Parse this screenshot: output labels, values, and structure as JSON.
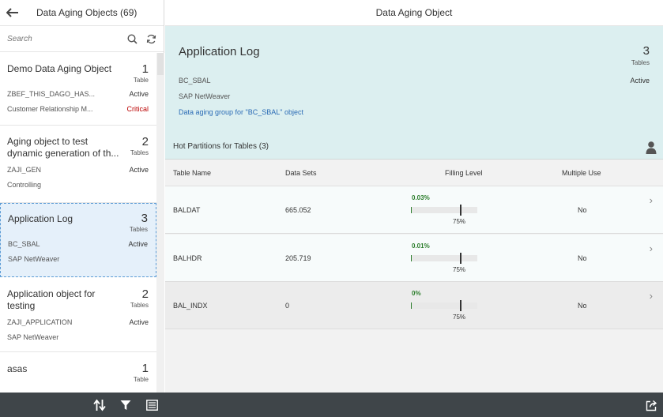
{
  "master": {
    "title": "Data Aging Objects (69)",
    "search_placeholder": "Search",
    "items": [
      {
        "title": "Demo Data Aging Object",
        "count": "1",
        "unit": "Table",
        "attr1": "ZBEF_THIS_DAGO_HAS...",
        "status1": "Active",
        "attr2": "Customer Relationship M...",
        "status2": "Critical"
      },
      {
        "title": "Aging object to test dynamic generation of th...",
        "count": "2",
        "unit": "Tables",
        "attr1": "ZAJI_GEN",
        "status1": "Active",
        "attr2": "Controlling"
      },
      {
        "title": "Application Log",
        "count": "3",
        "unit": "Tables",
        "attr1": "BC_SBAL",
        "status1": "Active",
        "attr2": "SAP NetWeaver"
      },
      {
        "title": "Application object for testing",
        "count": "2",
        "unit": "Tables",
        "attr1": "ZAJI_APPLICATION",
        "status1": "Active",
        "attr2": "SAP NetWeaver"
      },
      {
        "title": "asas",
        "count": "1",
        "unit": "Table"
      }
    ]
  },
  "detail": {
    "header_title": "Data Aging Object",
    "object": {
      "title": "Application Log",
      "count": "3",
      "unit": "Tables",
      "attr1": "BC_SBAL",
      "status": "Active",
      "attr2": "SAP NetWeaver",
      "link": "Data aging group for \"BC_SBAL\" object"
    },
    "section_title": "Hot Partitions for Tables (3)",
    "columns": [
      "Table Name",
      "Data Sets",
      "Filling Level",
      "Multiple Use"
    ],
    "rows": [
      {
        "name": "BALDAT",
        "data_sets": "665.052",
        "fill_pct": "0.03%",
        "fill_value": 0.0003,
        "target": "75%",
        "target_value": 0.75,
        "multiple_use": "No"
      },
      {
        "name": "BALHDR",
        "data_sets": "205.719",
        "fill_pct": "0.01%",
        "fill_value": 0.0001,
        "target": "75%",
        "target_value": 0.75,
        "multiple_use": "No"
      },
      {
        "name": "BAL_INDX",
        "data_sets": "0",
        "fill_pct": "0%",
        "fill_value": 0,
        "target": "75%",
        "target_value": 0.75,
        "multiple_use": "No"
      }
    ]
  },
  "colors": {
    "object_header_bg": "#dceff0",
    "selected_bg": "#e5f0fa",
    "critical": "#bb0000",
    "positive": "#2b7d2b",
    "link": "#2a6bb5",
    "footer_bg": "#3f4549"
  },
  "icons": {
    "back": "arrow-left-icon",
    "search": "search-icon",
    "refresh": "refresh-icon",
    "person": "person-icon",
    "sort": "sort-icon",
    "filter": "filter-icon",
    "group": "group-icon",
    "share": "share-icon",
    "chevron": "chevron-right-icon"
  }
}
